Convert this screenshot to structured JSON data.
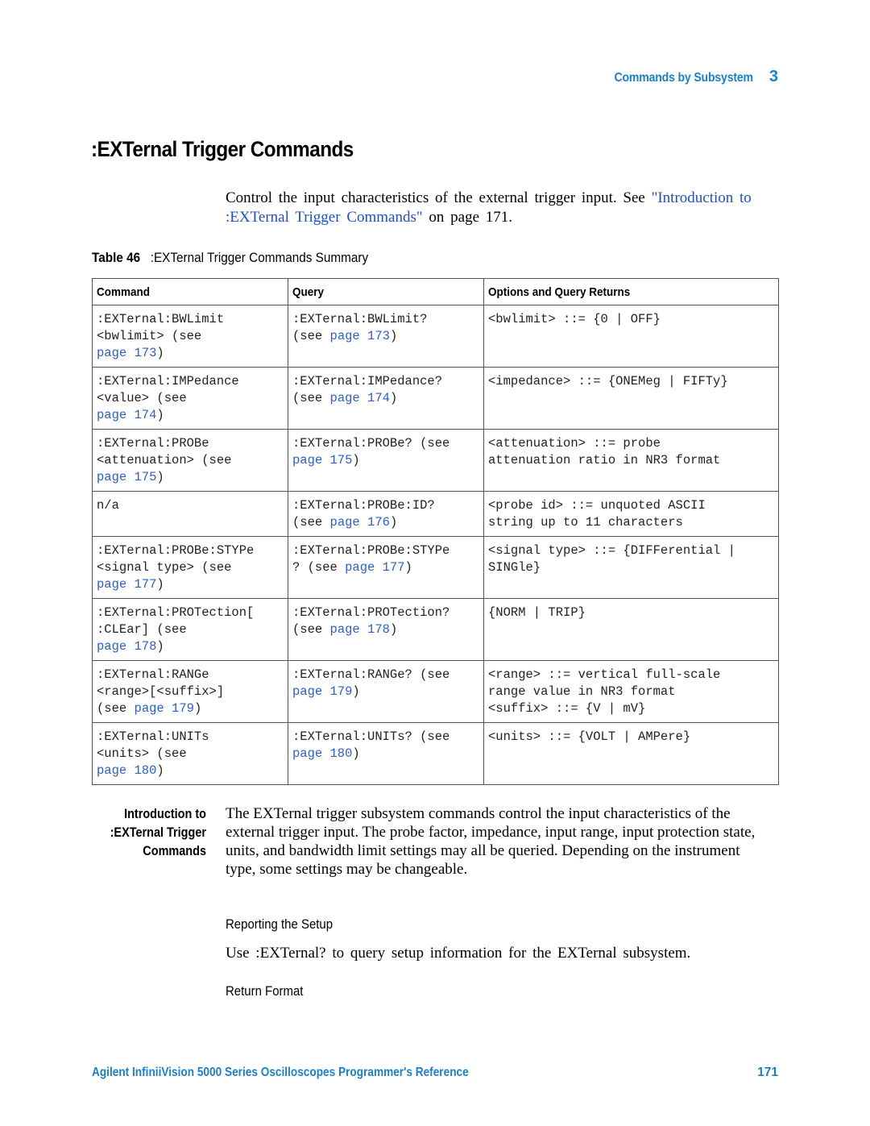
{
  "header": {
    "section_title": "Commands by Subsystem",
    "chapter_number": "3"
  },
  "page_title": ":EXTernal Trigger Commands",
  "intro": {
    "text_before_link": "Control the input characteristics of the external trigger input. See ",
    "link_text": "\"Introduction to :EXTernal Trigger Commands\"",
    "text_after_link": " on page 171."
  },
  "table": {
    "caption_number": "Table 46",
    "caption_title": ":EXTernal Trigger Commands Summary",
    "headers": [
      "Command",
      "Query",
      "Options and Query Returns"
    ],
    "rows": [
      {
        "command": [
          ":EXTernal:BWLimit",
          "<bwlimit> (see",
          "page 173)"
        ],
        "command_link": "page 173",
        "query": [
          ":EXTernal:BWLimit?",
          "(see page 173)"
        ],
        "query_link": "page 173",
        "options": [
          "<bwlimit> ::= {0 | OFF}"
        ]
      },
      {
        "command": [
          ":EXTernal:IMPedance",
          "<value> (see",
          "page 174)"
        ],
        "command_link": "page 174",
        "query": [
          ":EXTernal:IMPedance?",
          "(see page 174)"
        ],
        "query_link": "page 174",
        "options": [
          "<impedance> ::= {ONEMeg | FIFTy}"
        ]
      },
      {
        "command": [
          ":EXTernal:PROBe",
          "<attenuation> (see",
          "page 175)"
        ],
        "command_link": "page 175",
        "query": [
          ":EXTernal:PROBe? (see",
          "page 175)"
        ],
        "query_link": "page 175",
        "options": [
          "<attenuation> ::= probe",
          "attenuation ratio in NR3 format"
        ]
      },
      {
        "command": [
          "n/a"
        ],
        "command_link": "",
        "query": [
          ":EXTernal:PROBe:ID?",
          "(see page 176)"
        ],
        "query_link": "page 176",
        "options": [
          "<probe id> ::= unquoted ASCII",
          "string up to 11 characters"
        ]
      },
      {
        "command": [
          ":EXTernal:PROBe:STYPe",
          "<signal type> (see",
          "page 177)"
        ],
        "command_link": "page 177",
        "query": [
          ":EXTernal:PROBe:STYPe",
          "? (see page 177)"
        ],
        "query_link": "page 177",
        "options": [
          "<signal type> ::= {DIFFerential |",
          "SINGle}"
        ]
      },
      {
        "command": [
          ":EXTernal:PROTection[",
          ":CLEar] (see",
          "page 178)"
        ],
        "command_link": "page 178",
        "query": [
          ":EXTernal:PROTection?",
          "(see page 178)"
        ],
        "query_link": "page 178",
        "options": [
          "{NORM | TRIP}"
        ]
      },
      {
        "command": [
          ":EXTernal:RANGe",
          "<range>[<suffix>]",
          "(see page 179)"
        ],
        "command_link": "page 179",
        "query": [
          ":EXTernal:RANGe? (see",
          "page 179)"
        ],
        "query_link": "page 179",
        "options": [
          "<range> ::= vertical full-scale",
          "range value in NR3 format",
          "<suffix> ::= {V | mV}"
        ]
      },
      {
        "command": [
          ":EXTernal:UNITs",
          "<units> (see",
          "page 180)"
        ],
        "command_link": "page 180",
        "query": [
          ":EXTernal:UNITs? (see",
          "page 180)"
        ],
        "query_link": "page 180",
        "options": [
          "<units> ::= {VOLT | AMPere}"
        ]
      }
    ]
  },
  "intro_section": {
    "heading_lines": [
      "Introduction to",
      ":EXTernal Trigger",
      "Commands"
    ],
    "body": "The EXTernal trigger subsystem commands control the input characteristics of the external trigger input. The probe factor, impedance, input range, input protection state, units, and bandwidth limit settings may all be queried. Depending on the instrument type, some settings may be changeable."
  },
  "reporting": {
    "heading": "Reporting the Setup",
    "text": "Use :EXTernal? to query setup information for the EXTernal subsystem."
  },
  "return_format": {
    "heading": "Return Format"
  },
  "footer": {
    "title": "Agilent InfiniiVision 5000 Series Oscilloscopes Programmer's Reference",
    "page_number": "171"
  }
}
